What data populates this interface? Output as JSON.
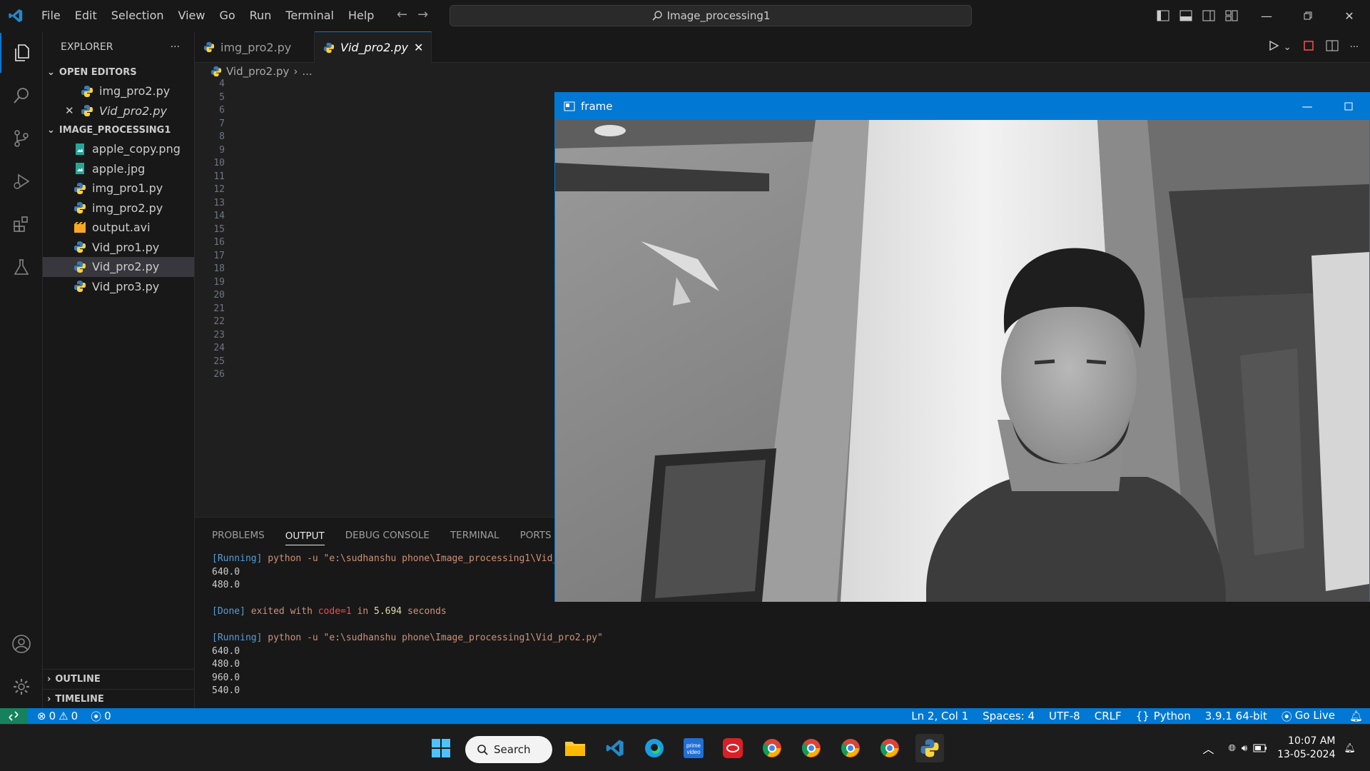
{
  "titlebar": {
    "menu": [
      "File",
      "Edit",
      "Selection",
      "View",
      "Go",
      "Run",
      "Terminal",
      "Help"
    ],
    "search": "Image_processing1"
  },
  "sidebar": {
    "title": "EXPLORER",
    "open_editors_label": "OPEN EDITORS",
    "open_editors": [
      "img_pro2.py",
      "Vid_pro2.py"
    ],
    "folder_label": "IMAGE_PROCESSING1",
    "files": [
      {
        "name": "apple_copy.png",
        "icon": "image-file-icon"
      },
      {
        "name": "apple.jpg",
        "icon": "image-file-icon"
      },
      {
        "name": "img_pro1.py",
        "icon": "python-file-icon"
      },
      {
        "name": "img_pro2.py",
        "icon": "python-file-icon"
      },
      {
        "name": "output.avi",
        "icon": "video-file-icon"
      },
      {
        "name": "Vid_pro1.py",
        "icon": "python-file-icon"
      },
      {
        "name": "Vid_pro2.py",
        "icon": "python-file-icon"
      },
      {
        "name": "Vid_pro3.py",
        "icon": "python-file-icon"
      }
    ],
    "outline_label": "OUTLINE",
    "timeline_label": "TIMELINE"
  },
  "editor": {
    "tabs": [
      "img_pro2.py",
      "Vid_pro2.py"
    ],
    "breadcrumb_file": "Vid_pro2.py",
    "breadcrumb_rest": "...",
    "line_numbers": [
      "4",
      "5",
      "6",
      "7",
      "8",
      "9",
      "10",
      "11",
      "12",
      "13",
      "14",
      "15",
      "16",
      "17",
      "18",
      "19",
      "20",
      "21",
      "22",
      "23",
      "24",
      "25",
      "26"
    ]
  },
  "panel": {
    "tabs": [
      "PROBLEMS",
      "OUTPUT",
      "DEBUG CONSOLE",
      "TERMINAL",
      "PORTS"
    ],
    "run1_cmd": "python -u \"e:\\sudhanshu phone\\Image_processing1\\Vid_",
    "run2_cmd": "python -u \"e:\\sudhanshu phone\\Image_processing1\\Vid_pro2.py\"",
    "running_tag": "[Running]",
    "done_tag": "[Done]",
    "values1": [
      "640.0",
      "480.0"
    ],
    "values2": [
      "640.0",
      "480.0",
      "960.0",
      "540.0"
    ],
    "done_text1": "exited with",
    "done_code": "code=1",
    "done_text2": "in",
    "done_time": "5.694",
    "done_text3": "seconds"
  },
  "statusbar": {
    "errors": "0",
    "warnings": "0",
    "ports": "0",
    "position": "Ln 2, Col 1",
    "spaces": "Spaces: 4",
    "encoding": "UTF-8",
    "eol": "CRLF",
    "language": "Python",
    "interpreter": "3.9.1 64-bit",
    "golive": "Go Live"
  },
  "frame_window": {
    "title": "frame"
  },
  "taskbar": {
    "search_label": "Search",
    "time": "10:07 AM",
    "date": "13-05-2024"
  },
  "colors": {
    "accent": "#0078d4",
    "remote": "#16825d"
  }
}
